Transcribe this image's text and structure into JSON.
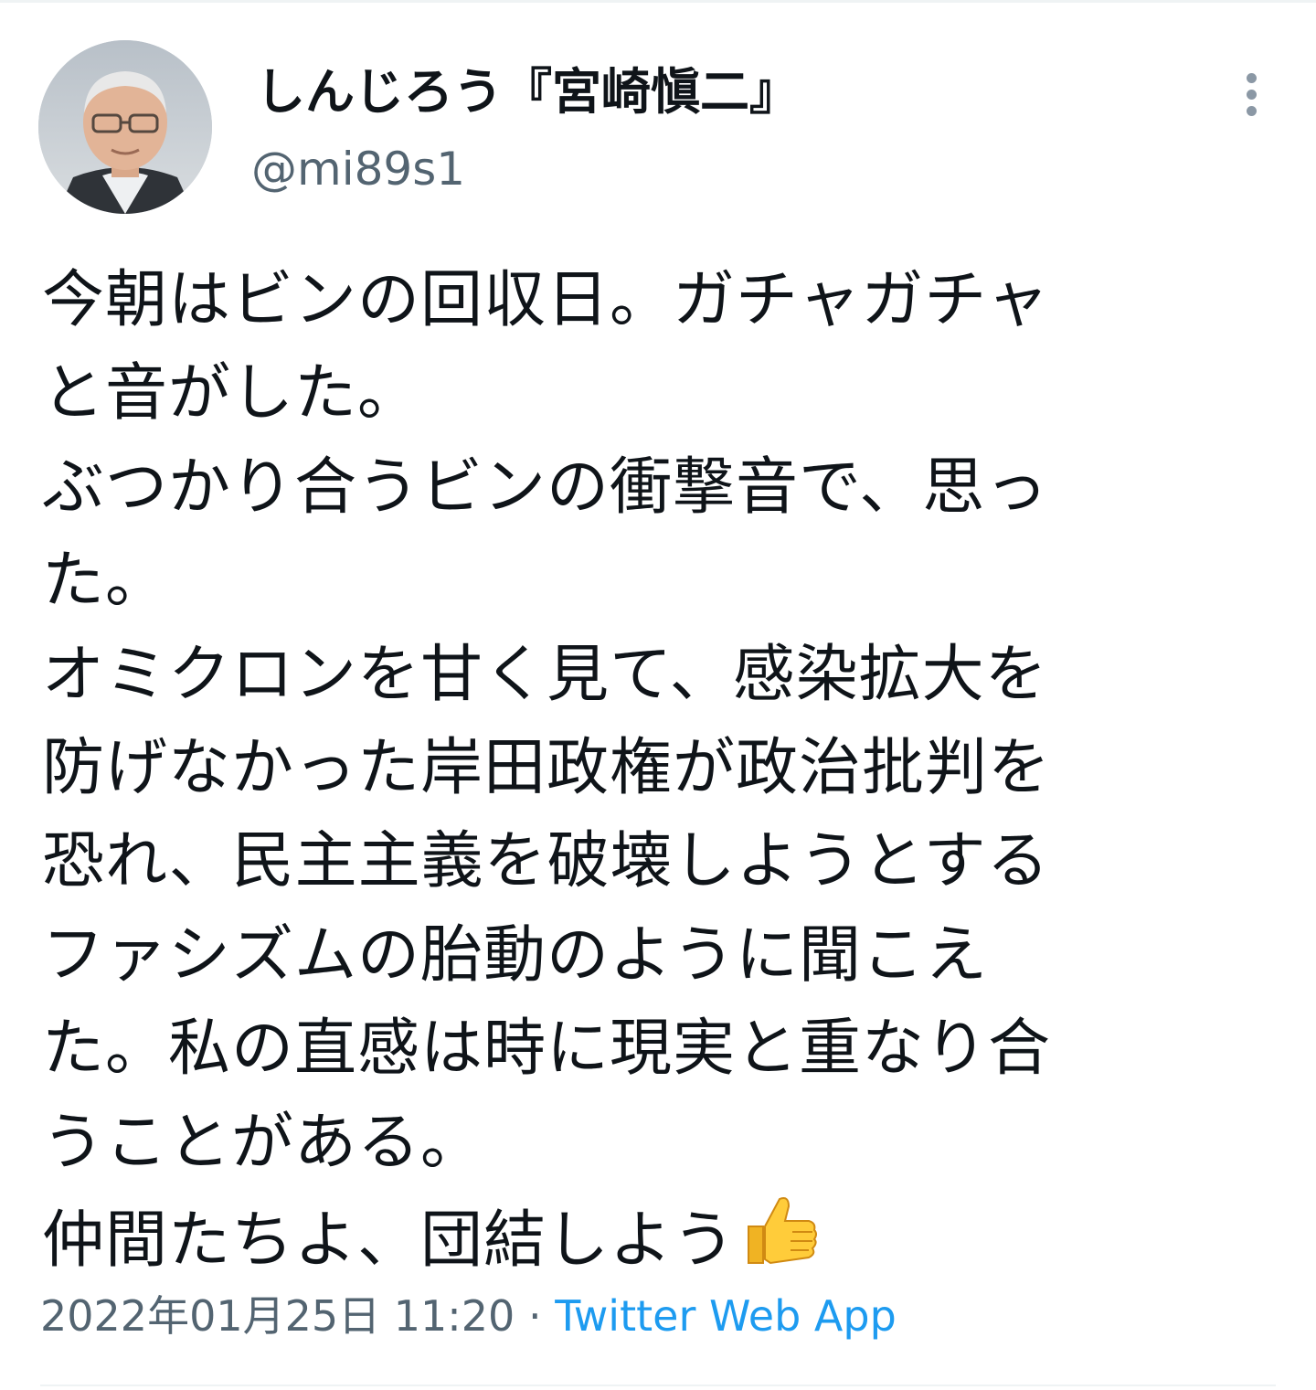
{
  "tweet": {
    "author": {
      "display_name": "しんじろう『宮崎愼二』",
      "handle": "@mi89s1",
      "avatar_icon": "profile-photo"
    },
    "more_icon": "more-vertical-icon",
    "text_lines": [
      "今朝はビンの回収日。ガチャガチャ",
      "と音がした。",
      "ぶつかり合うビンの衝撃音で、思っ",
      "た。",
      "オミクロンを甘く見て、感染拡大を",
      "防げなかった岸田政権が政治批判を",
      "恐れ、民主主義を破壊しようとする",
      "ファシズムの胎動のように聞こえ",
      "た。私の直感は時に現実と重なり合",
      "うことがある。",
      "仲間たちよ、団結しよう"
    ],
    "emoji": "thumbs-up-icon",
    "timestamp": "2022年01月25日 11:20",
    "separator": " · ",
    "source": "Twitter Web App"
  },
  "colors": {
    "text": "#0f1419",
    "secondary": "#536471",
    "link": "#1d9bf0",
    "divider": "#eff3f4"
  }
}
